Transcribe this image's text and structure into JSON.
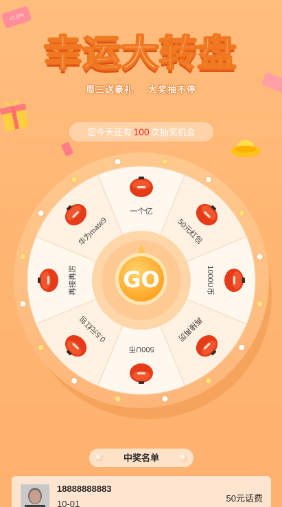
{
  "tag_corner": "+0.5%",
  "title": "幸运大转盘",
  "subtitle": [
    "周三送豪礼",
    "大奖抽不停"
  ],
  "chance": {
    "prefix": "您今天还有",
    "count": "100",
    "suffix": "次抽奖机会"
  },
  "prizes": [
    "一个亿",
    "50元红包",
    "1000U币",
    "再接再厉",
    "500U币",
    "0.5元红包",
    "再接再厉",
    "华为mate9"
  ],
  "go_label": "GO",
  "winners": {
    "heading": "中奖名单",
    "items": [
      {
        "phone": "18888888883",
        "date": "10-01",
        "prize": "50元话费"
      }
    ]
  },
  "colors": {
    "accent": "#F07820",
    "count_red": "#F42B2B",
    "go_orange": "#FFA82A"
  }
}
